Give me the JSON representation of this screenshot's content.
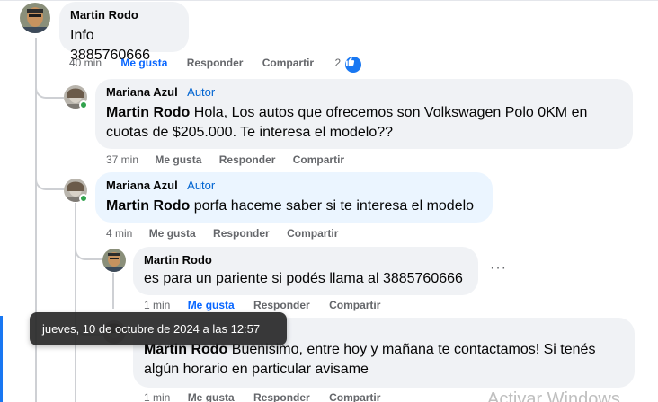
{
  "thread": {
    "c1": {
      "author": "Martin Rodo",
      "text": "Info 3885760666",
      "time": "40 min",
      "like": "Me gusta",
      "reply": "Responder",
      "share": "Compartir",
      "reaction_count": "2"
    },
    "c2": {
      "author": "Mariana Azul",
      "badge": "Autor",
      "mention": "Martin Rodo",
      "text": " Hola, Los autos que ofrecemos son Volkswagen Polo 0KM en cuotas de $205.000. Te interesa el modelo??",
      "time": "37 min",
      "like": "Me gusta",
      "reply": "Responder",
      "share": "Compartir"
    },
    "c3": {
      "author": "Mariana Azul",
      "badge": "Autor",
      "mention": "Martin Rodo",
      "text": " porfa haceme saber si te interesa el modelo",
      "time": "4 min",
      "like": "Me gusta",
      "reply": "Responder",
      "share": "Compartir"
    },
    "c4": {
      "author": "Martin Rodo",
      "text": "es para un pariente si podés llama al 3885760666",
      "time": "1 min",
      "like": "Me gusta",
      "reply": "Responder",
      "share": "Compartir",
      "more": "···"
    },
    "c5": {
      "mention": "Martin Rodo",
      "text": " Buenisimo, entre hoy y mañana te contactamos! Si tenés algún horario en particular avisame",
      "time": "1 min",
      "like": "Me gusta",
      "reply": "Responder",
      "share": "Compartir"
    }
  },
  "tooltip": "jueves, 10 de octubre de 2024 a las 12:57",
  "watermark": "Activar Windows",
  "colors": {
    "accent": "#0866ff",
    "bubble": "#f0f2f5",
    "bubble_highlight": "#ebf5ff",
    "online": "#31a24c"
  }
}
